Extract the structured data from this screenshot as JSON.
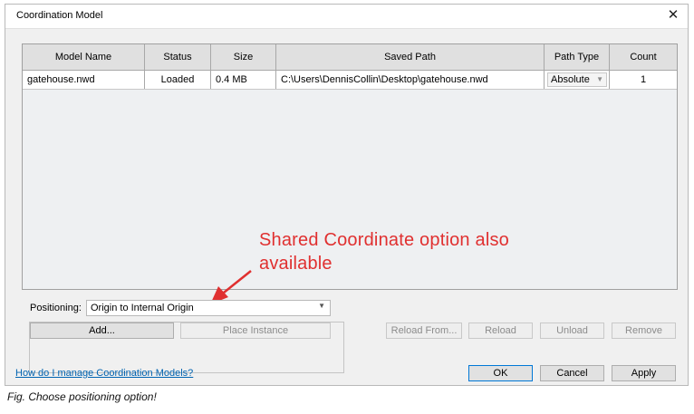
{
  "dialog": {
    "title": "Coordination Model",
    "close_symbol": "✕"
  },
  "table": {
    "columns": [
      "Model Name",
      "Status",
      "Size",
      "Saved Path",
      "Path Type",
      "Count"
    ],
    "rows": [
      {
        "model_name": "gatehouse.nwd",
        "status": "Loaded",
        "size": "0.4 MB",
        "saved_path": "C:\\Users\\DennisCollin\\Desktop\\gatehouse.nwd",
        "path_type": "Absolute",
        "count": "1"
      }
    ]
  },
  "annotation": {
    "line1": "Shared Coordinate option also",
    "line2": "available",
    "color": "#e03030"
  },
  "positioning": {
    "label": "Positioning:",
    "selected": "Origin to Internal Origin"
  },
  "buttons": {
    "add": "Add...",
    "place_instance": "Place Instance",
    "reload_from": "Reload From...",
    "reload": "Reload",
    "unload": "Unload",
    "remove": "Remove",
    "ok": "OK",
    "cancel": "Cancel",
    "apply": "Apply"
  },
  "help_link": "How do I manage Coordination Models?",
  "caption": "Fig. Choose positioning option!"
}
